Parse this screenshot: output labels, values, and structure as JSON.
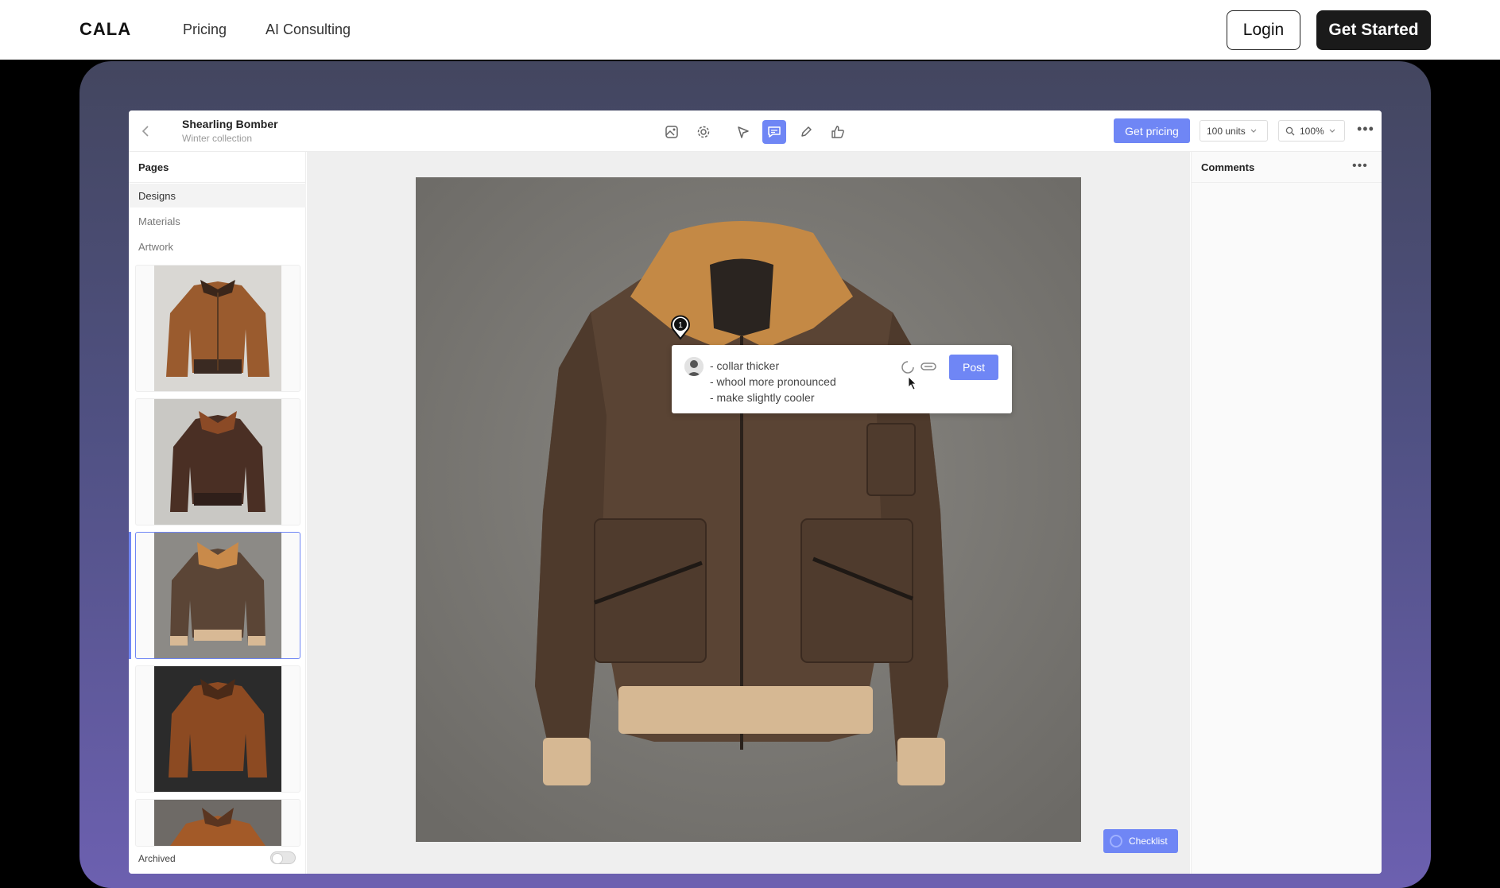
{
  "site": {
    "brand": "CALA",
    "nav": [
      "Pricing",
      "AI Consulting"
    ],
    "login": "Login",
    "get_started": "Get Started"
  },
  "app": {
    "title": "Shearling Bomber",
    "subtitle": "Winter collection",
    "toolbar": {
      "tools": [
        "image-icon",
        "settings-icon",
        "select-arrow-icon",
        "comment-icon",
        "pencil-icon",
        "thumbs-up-icon"
      ],
      "active_tool": "comment-icon",
      "get_pricing": "Get pricing",
      "units": "100 units",
      "zoom": "100%"
    },
    "sidebar": {
      "header": "Pages",
      "items": [
        "Designs",
        "Materials",
        "Artwork"
      ],
      "active_item": "Designs",
      "archived_label": "Archived",
      "archived_on": false
    },
    "comment": {
      "pin_number": "1",
      "lines": [
        "- collar thicker",
        "- whool more pronounced",
        "- make slightly cooler"
      ],
      "post": "Post"
    },
    "checklist": "Checklist",
    "comments_panel": {
      "header": "Comments"
    }
  },
  "colors": {
    "accent": "#6f86f5",
    "dark_button": "#1a1a1a"
  }
}
